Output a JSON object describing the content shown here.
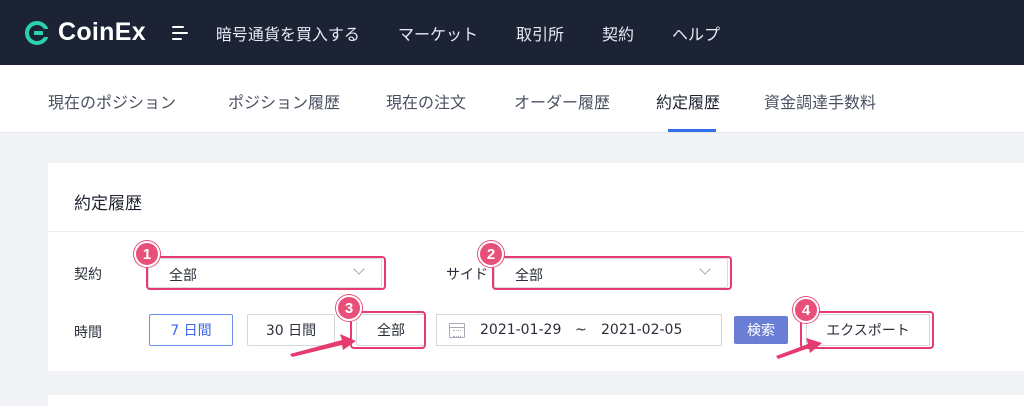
{
  "brand": {
    "name": "CoinEx",
    "accent": "#2bd1a8"
  },
  "nav": [
    "暗号通貨を買入する",
    "マーケット",
    "取引所",
    "契約",
    "ヘルプ"
  ],
  "subtabs": [
    "現在のポジション",
    "ポジション履歴",
    "現在の注文",
    "オーダー履歴",
    "約定履歴",
    "資金調達手数料"
  ],
  "active_subtab": "約定履歴",
  "card": {
    "title": "約定履歴",
    "contract_label": "契約",
    "contract_value": "全部",
    "side_label": "サイド",
    "side_value": "全部",
    "time_label": "時間",
    "time_buttons": [
      "7 日間",
      "30 日間",
      "全部"
    ],
    "date_from": "2021-01-29",
    "date_sep": "~",
    "date_to": "2021-02-05",
    "search_label": "検索",
    "export_label": "エクスポート"
  },
  "annotations": [
    "1",
    "2",
    "3",
    "4"
  ],
  "colors": {
    "topbar": "#1b2335",
    "highlight": "#e63b6e",
    "active_tab": "#2e6ee6"
  }
}
